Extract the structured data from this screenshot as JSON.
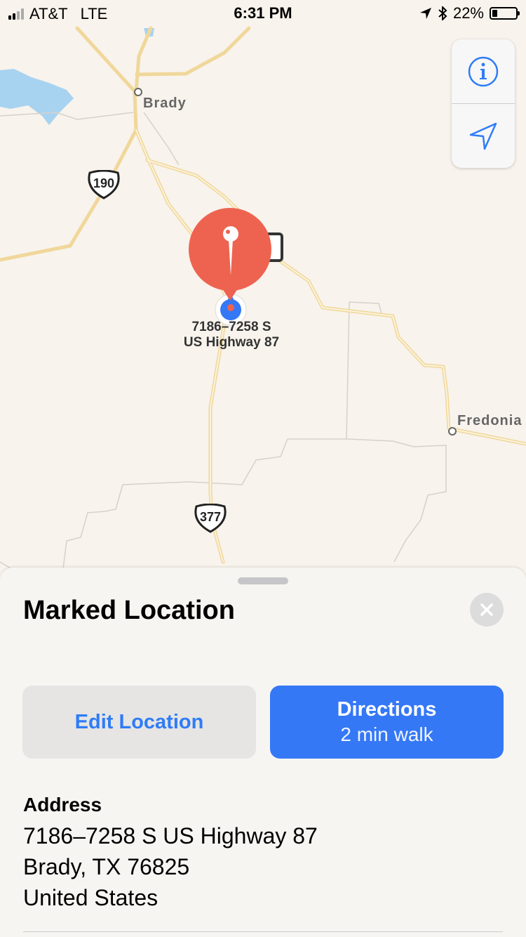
{
  "status_bar": {
    "carrier": "AT&T",
    "network": "LTE",
    "time": "6:31 PM",
    "battery": "22%",
    "battery_level": 0.22,
    "icons": [
      "location-arrow-icon",
      "bluetooth-icon",
      "battery-icon"
    ]
  },
  "map": {
    "place_labels": {
      "brady": "Brady",
      "fredonia": "Fredonia"
    },
    "highway_shields": {
      "us190": "190",
      "us377": "377"
    },
    "pin_label": {
      "line1": "7186–7258 S",
      "line2": "US Highway 87"
    },
    "controls": [
      "info-icon",
      "location-arrow-icon"
    ],
    "colors": {
      "pin": "#ee6350",
      "user_location": "#3478f6",
      "road": "#f4d88a",
      "water": "#a8d3f0"
    }
  },
  "sheet": {
    "title": "Marked Location",
    "edit_button": "Edit Location",
    "directions_button": {
      "label": "Directions",
      "sub": "2 min walk"
    },
    "address": {
      "heading": "Address",
      "line1": "7186–7258 S US Highway 87",
      "line2": "Brady, TX  76825",
      "line3": "United States"
    }
  }
}
